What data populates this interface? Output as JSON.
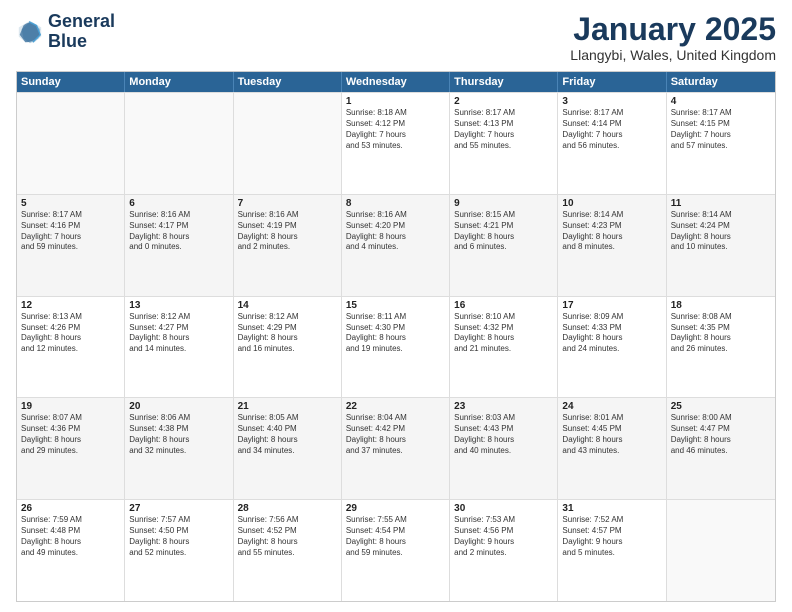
{
  "logo": {
    "line1": "General",
    "line2": "Blue"
  },
  "title": "January 2025",
  "subtitle": "Llangybi, Wales, United Kingdom",
  "headers": [
    "Sunday",
    "Monday",
    "Tuesday",
    "Wednesday",
    "Thursday",
    "Friday",
    "Saturday"
  ],
  "weeks": [
    [
      {
        "day": "",
        "info": ""
      },
      {
        "day": "",
        "info": ""
      },
      {
        "day": "",
        "info": ""
      },
      {
        "day": "1",
        "info": "Sunrise: 8:18 AM\nSunset: 4:12 PM\nDaylight: 7 hours\nand 53 minutes."
      },
      {
        "day": "2",
        "info": "Sunrise: 8:17 AM\nSunset: 4:13 PM\nDaylight: 7 hours\nand 55 minutes."
      },
      {
        "day": "3",
        "info": "Sunrise: 8:17 AM\nSunset: 4:14 PM\nDaylight: 7 hours\nand 56 minutes."
      },
      {
        "day": "4",
        "info": "Sunrise: 8:17 AM\nSunset: 4:15 PM\nDaylight: 7 hours\nand 57 minutes."
      }
    ],
    [
      {
        "day": "5",
        "info": "Sunrise: 8:17 AM\nSunset: 4:16 PM\nDaylight: 7 hours\nand 59 minutes."
      },
      {
        "day": "6",
        "info": "Sunrise: 8:16 AM\nSunset: 4:17 PM\nDaylight: 8 hours\nand 0 minutes."
      },
      {
        "day": "7",
        "info": "Sunrise: 8:16 AM\nSunset: 4:19 PM\nDaylight: 8 hours\nand 2 minutes."
      },
      {
        "day": "8",
        "info": "Sunrise: 8:16 AM\nSunset: 4:20 PM\nDaylight: 8 hours\nand 4 minutes."
      },
      {
        "day": "9",
        "info": "Sunrise: 8:15 AM\nSunset: 4:21 PM\nDaylight: 8 hours\nand 6 minutes."
      },
      {
        "day": "10",
        "info": "Sunrise: 8:14 AM\nSunset: 4:23 PM\nDaylight: 8 hours\nand 8 minutes."
      },
      {
        "day": "11",
        "info": "Sunrise: 8:14 AM\nSunset: 4:24 PM\nDaylight: 8 hours\nand 10 minutes."
      }
    ],
    [
      {
        "day": "12",
        "info": "Sunrise: 8:13 AM\nSunset: 4:26 PM\nDaylight: 8 hours\nand 12 minutes."
      },
      {
        "day": "13",
        "info": "Sunrise: 8:12 AM\nSunset: 4:27 PM\nDaylight: 8 hours\nand 14 minutes."
      },
      {
        "day": "14",
        "info": "Sunrise: 8:12 AM\nSunset: 4:29 PM\nDaylight: 8 hours\nand 16 minutes."
      },
      {
        "day": "15",
        "info": "Sunrise: 8:11 AM\nSunset: 4:30 PM\nDaylight: 8 hours\nand 19 minutes."
      },
      {
        "day": "16",
        "info": "Sunrise: 8:10 AM\nSunset: 4:32 PM\nDaylight: 8 hours\nand 21 minutes."
      },
      {
        "day": "17",
        "info": "Sunrise: 8:09 AM\nSunset: 4:33 PM\nDaylight: 8 hours\nand 24 minutes."
      },
      {
        "day": "18",
        "info": "Sunrise: 8:08 AM\nSunset: 4:35 PM\nDaylight: 8 hours\nand 26 minutes."
      }
    ],
    [
      {
        "day": "19",
        "info": "Sunrise: 8:07 AM\nSunset: 4:36 PM\nDaylight: 8 hours\nand 29 minutes."
      },
      {
        "day": "20",
        "info": "Sunrise: 8:06 AM\nSunset: 4:38 PM\nDaylight: 8 hours\nand 32 minutes."
      },
      {
        "day": "21",
        "info": "Sunrise: 8:05 AM\nSunset: 4:40 PM\nDaylight: 8 hours\nand 34 minutes."
      },
      {
        "day": "22",
        "info": "Sunrise: 8:04 AM\nSunset: 4:42 PM\nDaylight: 8 hours\nand 37 minutes."
      },
      {
        "day": "23",
        "info": "Sunrise: 8:03 AM\nSunset: 4:43 PM\nDaylight: 8 hours\nand 40 minutes."
      },
      {
        "day": "24",
        "info": "Sunrise: 8:01 AM\nSunset: 4:45 PM\nDaylight: 8 hours\nand 43 minutes."
      },
      {
        "day": "25",
        "info": "Sunrise: 8:00 AM\nSunset: 4:47 PM\nDaylight: 8 hours\nand 46 minutes."
      }
    ],
    [
      {
        "day": "26",
        "info": "Sunrise: 7:59 AM\nSunset: 4:48 PM\nDaylight: 8 hours\nand 49 minutes."
      },
      {
        "day": "27",
        "info": "Sunrise: 7:57 AM\nSunset: 4:50 PM\nDaylight: 8 hours\nand 52 minutes."
      },
      {
        "day": "28",
        "info": "Sunrise: 7:56 AM\nSunset: 4:52 PM\nDaylight: 8 hours\nand 55 minutes."
      },
      {
        "day": "29",
        "info": "Sunrise: 7:55 AM\nSunset: 4:54 PM\nDaylight: 8 hours\nand 59 minutes."
      },
      {
        "day": "30",
        "info": "Sunrise: 7:53 AM\nSunset: 4:56 PM\nDaylight: 9 hours\nand 2 minutes."
      },
      {
        "day": "31",
        "info": "Sunrise: 7:52 AM\nSunset: 4:57 PM\nDaylight: 9 hours\nand 5 minutes."
      },
      {
        "day": "",
        "info": ""
      }
    ]
  ]
}
